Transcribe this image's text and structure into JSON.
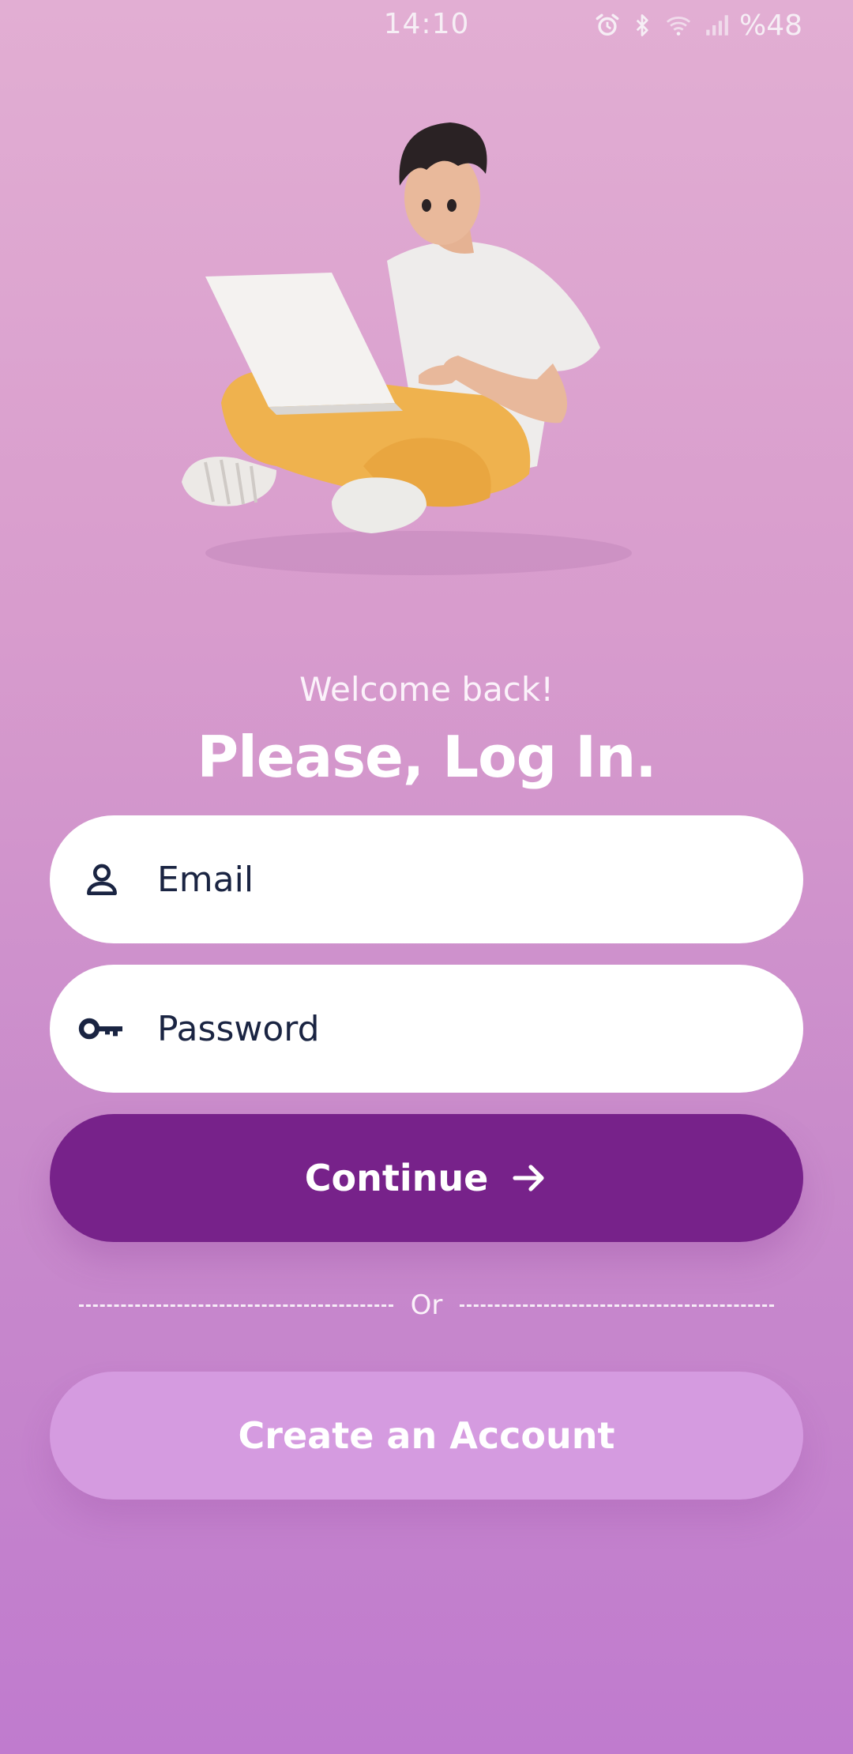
{
  "status_bar": {
    "time": "14:10",
    "battery": "%48",
    "icons": [
      "alarm-icon",
      "bluetooth-icon",
      "wifi-icon",
      "signal-icon"
    ]
  },
  "hero": {
    "illustration": "person-with-laptop-illustration"
  },
  "header": {
    "welcome": "Welcome back!",
    "title": "Please, Log In."
  },
  "form": {
    "email": {
      "placeholder": "Email",
      "value": "",
      "icon": "person-icon"
    },
    "password": {
      "placeholder": "Password",
      "value": "",
      "icon": "key-icon"
    },
    "continue_label": "Continue",
    "continue_icon": "arrow-right-icon"
  },
  "divider": {
    "label": "Or"
  },
  "create_account_label": "Create an Account",
  "colors": {
    "primary": "#77228a",
    "secondary_button": "#d59be0",
    "field_text": "#1a2442",
    "background_top": "#e2aed3",
    "background_bottom": "#c07bce"
  }
}
